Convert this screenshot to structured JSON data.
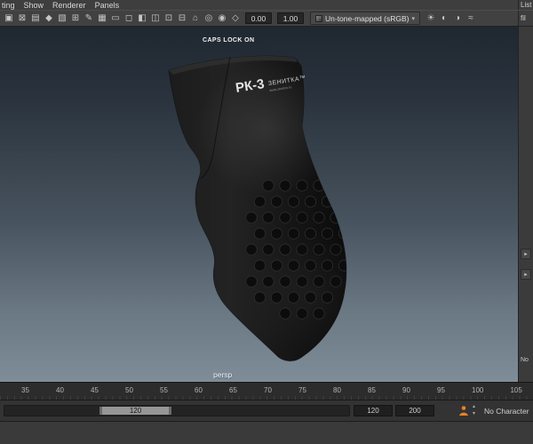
{
  "panel_menubar": {
    "items": [
      "ting",
      "Show",
      "Renderer",
      "Panels"
    ],
    "right_label": "List"
  },
  "viewport_toolbar": {
    "icons_left": [
      {
        "name": "select-camera-icon",
        "glyph": "▣"
      },
      {
        "name": "lock-camera-icon",
        "glyph": "⊠"
      },
      {
        "name": "camera-attributes-icon",
        "glyph": "▤"
      },
      {
        "name": "bookmarks-icon",
        "glyph": "◆"
      },
      {
        "name": "image-plane-icon",
        "glyph": "▧"
      },
      {
        "name": "pan-zoom-icon",
        "glyph": "⊞"
      },
      {
        "name": "grease-pencil-icon",
        "glyph": "✎"
      },
      {
        "name": "grid-icon",
        "glyph": "▦"
      },
      {
        "name": "film-gate-icon",
        "glyph": "▭"
      },
      {
        "name": "resolution-gate-icon",
        "glyph": "◻"
      },
      {
        "name": "gate-mask-icon",
        "glyph": "◧"
      },
      {
        "name": "field-chart-icon",
        "glyph": "◫"
      },
      {
        "name": "safe-action-icon",
        "glyph": "⊡"
      },
      {
        "name": "safe-title-icon",
        "glyph": "⊟"
      },
      {
        "name": "frame-all-icon",
        "glyph": "⌂"
      },
      {
        "name": "frame-selection-icon",
        "glyph": "◎"
      },
      {
        "name": "isolate-select-icon",
        "glyph": "◉"
      },
      {
        "name": "xray-icon",
        "glyph": "◇"
      }
    ],
    "exposure_value": "0.00",
    "gamma_value": "1.00",
    "view_transform": "Un-tone-mapped (sRGB)",
    "icons_right": [
      {
        "name": "lights-icon",
        "glyph": "☀"
      },
      {
        "name": "shadows-icon",
        "glyph": "◐"
      },
      {
        "name": "ambient-occlusion-icon",
        "glyph": "◑"
      },
      {
        "name": "motion-blur-icon",
        "glyph": "≈"
      }
    ],
    "right_label": "fil"
  },
  "viewport": {
    "hud_text": "CAPS LOCK ON",
    "camera_label": "persp",
    "model_text": {
      "line1": "РК-3",
      "line2": "ЗЕНИТКА™",
      "line3": "www.zenitco.ru"
    }
  },
  "right_panel": {
    "expand_arrows": [
      "▸",
      "▸"
    ],
    "bottom_label": "No"
  },
  "timeline": {
    "ticks": [
      "35",
      "40",
      "45",
      "50",
      "55",
      "60",
      "65",
      "70",
      "75",
      "80",
      "85",
      "90",
      "95",
      "100",
      "105"
    ]
  },
  "range_bar": {
    "range_label": "120",
    "playback_end": "120",
    "animation_end": "200",
    "character_set": "No Character"
  },
  "icons": {
    "caret_down": "▾",
    "spinner_up": "▴",
    "spinner_down": "▾"
  },
  "colors": {
    "viewport_top": "#1f2831",
    "viewport_bottom": "#7f8d99",
    "accent_orange": "#e8822a"
  }
}
